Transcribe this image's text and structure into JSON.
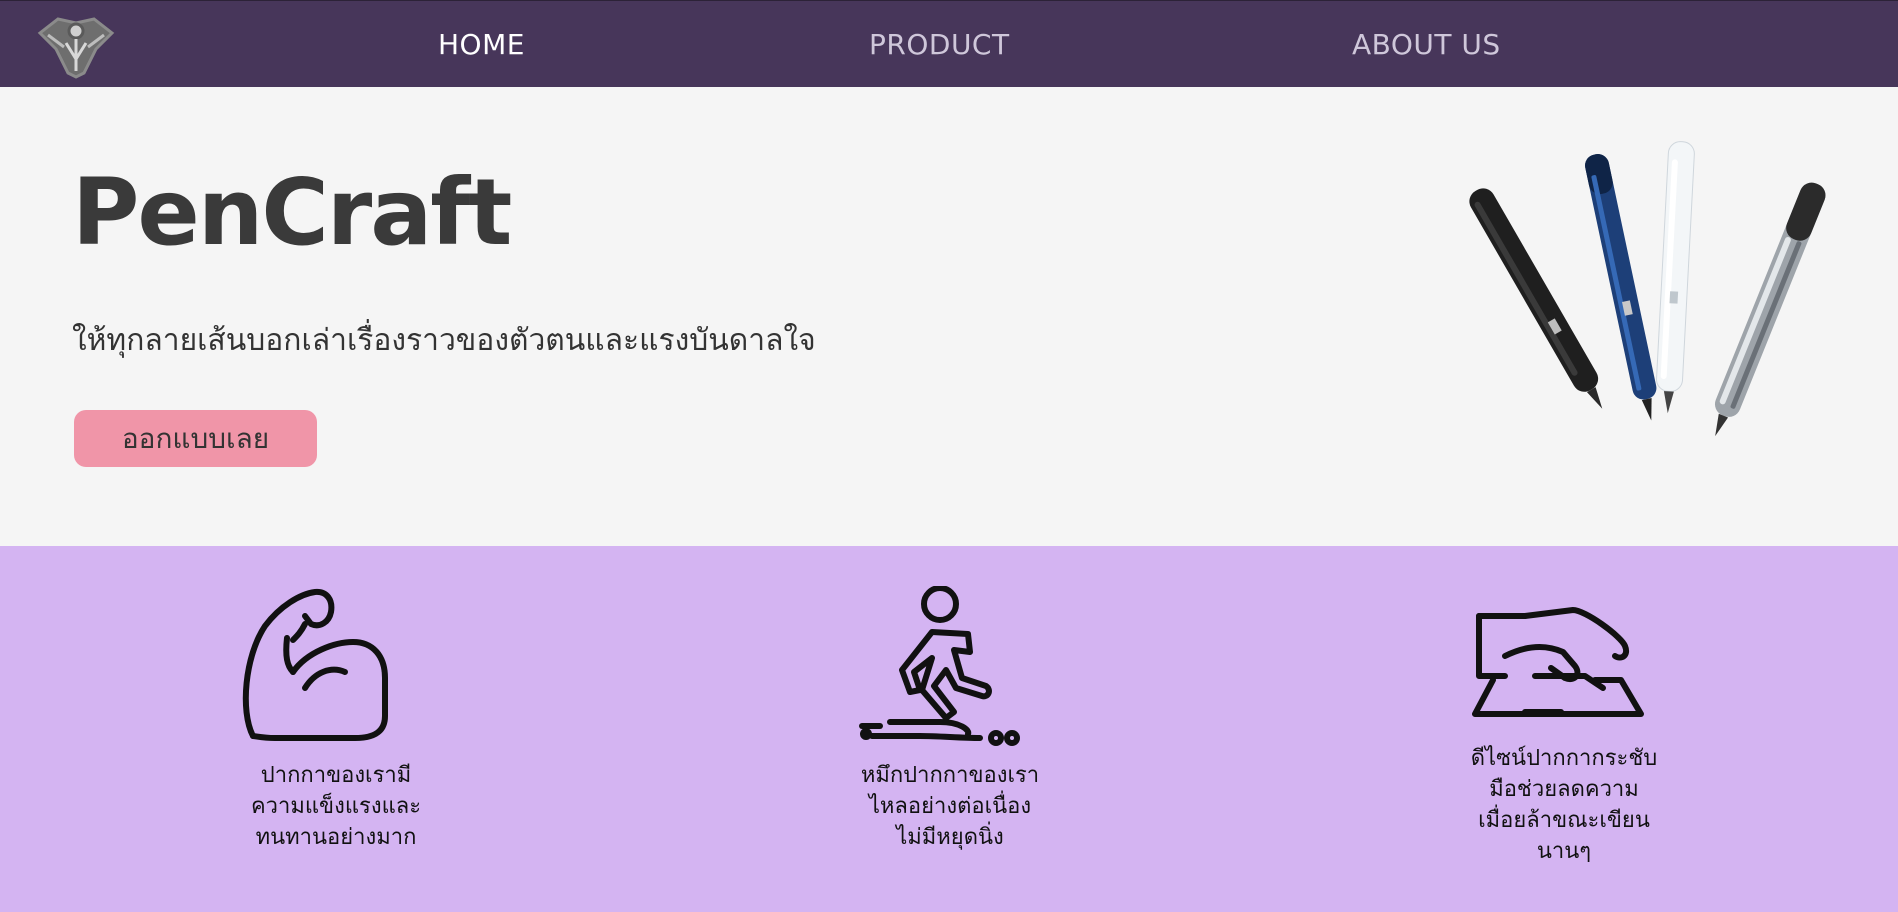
{
  "nav": {
    "logo_icon": "shield-crest-logo",
    "links": [
      {
        "label": "HOME",
        "active": true
      },
      {
        "label": "PRODUCT",
        "active": false
      },
      {
        "label": "ABOUT US",
        "active": false
      }
    ]
  },
  "hero": {
    "title": "PenCraft",
    "subtitle": "ให้ทุกลายเส้นบอกเล่าเรื่องราวของตัวตนและแรงบันดาลใจ",
    "cta_label": "ออกแบบเลย",
    "image": "four-pens-image"
  },
  "features": [
    {
      "icon": "flexed-bicep-icon",
      "text_lines": [
        "ปากกาของเรามี",
        "ความแข็งแรงและ",
        "ทนทานอย่างมาก"
      ]
    },
    {
      "icon": "slipping-person-icon",
      "text_lines": [
        "หมึกปากกาของเรา",
        "ไหลอย่างต่อเนื่อง",
        "ไม่มีหยุดนิ่ง"
      ]
    },
    {
      "icon": "hand-on-pad-icon",
      "text_lines": [
        "ดีไซน์ปากกากระชับ",
        "มือช่วยลดความ",
        "เมื่อยล้าขณะเขียน",
        "นานๆ"
      ]
    }
  ],
  "colors": {
    "navbar": "#47365a",
    "hero_background": "#f5f5f5",
    "features_background": "#d4b4f2",
    "cta": "#f095a8"
  }
}
